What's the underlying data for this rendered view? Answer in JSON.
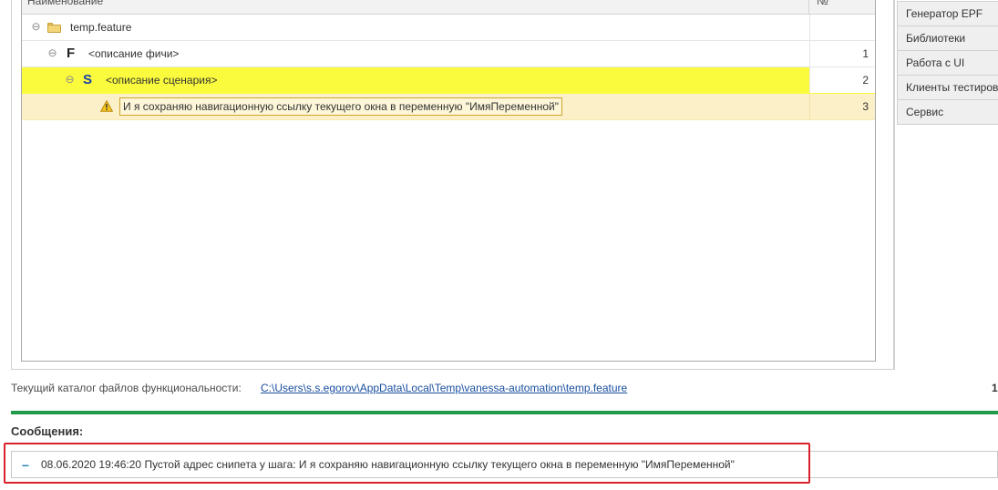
{
  "tree": {
    "columns": {
      "name": "Наименование",
      "number": "№"
    },
    "rows": [
      {
        "label": "temp.feature",
        "number": ""
      },
      {
        "letter": "F",
        "label": "<описание фичи>",
        "number": "1"
      },
      {
        "letter": "S",
        "label": "<описание сценария>",
        "number": "2"
      },
      {
        "label": "И я сохраняю навигационную ссылку текущего окна в переменную \"ИмяПеременной\"",
        "number": "3"
      }
    ]
  },
  "side_menu": {
    "items": [
      {
        "label": "Генератор EPF"
      },
      {
        "label": "Библиотеки"
      },
      {
        "label": "Работа с UI"
      },
      {
        "label": "Клиенты тестиров"
      },
      {
        "label": "Сервис"
      }
    ]
  },
  "status": {
    "catalog_label": "Текущий каталог файлов функциональности:",
    "catalog_path": "C:\\Users\\s.s.egorov\\AppData\\Local\\Temp\\vanessa-automation\\temp.feature",
    "right_value": "1"
  },
  "messages": {
    "title": "Сообщения:",
    "items": [
      {
        "text": "08.06.2020 19:46:20 Пустой адрес снипета у шага: И я сохраняю навигационную ссылку текущего окна в переменную \"ИмяПеременной\""
      }
    ]
  },
  "colors": {
    "scenario_highlight": "#fbfb3e",
    "step_highlight": "#fcf0c8",
    "accent_green": "#219a4a",
    "error_outline": "#d8222a",
    "link": "#1a4fa0"
  },
  "icons": {
    "feature_file": "folder-icon",
    "step_warning": "warning-icon",
    "collapse": "collapse-icon",
    "message": "dash-icon"
  }
}
